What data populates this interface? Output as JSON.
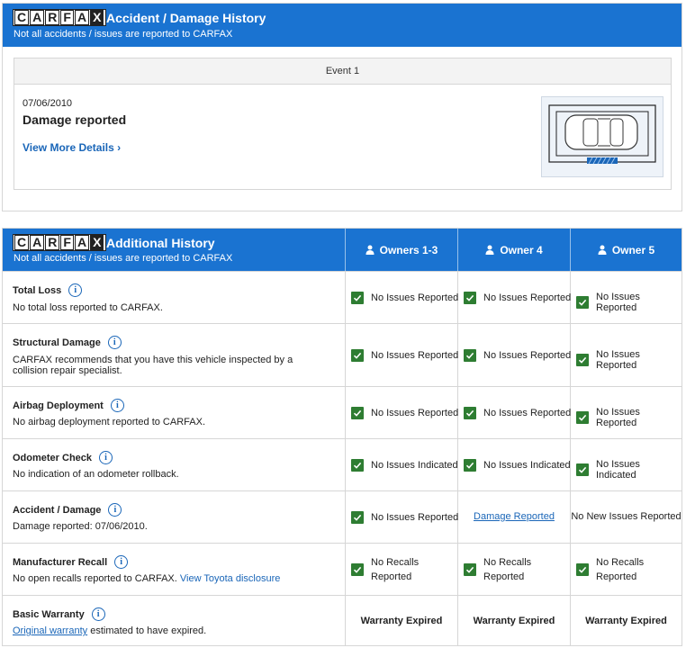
{
  "brand": {
    "letters": [
      "C",
      "A",
      "R",
      "F",
      "A",
      "X"
    ],
    "accent": "#1a73d1",
    "check_color": "#2e7d32"
  },
  "accident_card": {
    "title": "Accident / Damage History",
    "subtitle": "Not all accidents / issues are reported to CARFAX",
    "event_header": "Event 1",
    "event_date": "07/06/2010",
    "event_title": "Damage reported",
    "view_more": "View More Details ›"
  },
  "history_card": {
    "title": "Additional History",
    "subtitle": "Not all accidents / issues are reported to CARFAX",
    "owners": [
      "Owners 1-3",
      "Owner 4",
      "Owner 5"
    ],
    "rows": [
      {
        "title": "Total Loss",
        "desc": "No total loss reported to CARFAX.",
        "cells": [
          "No Issues Reported",
          "No Issues Reported",
          "No Issues Reported"
        ]
      },
      {
        "title": "Structural Damage",
        "desc": "CARFAX recommends that you have this vehicle inspected by a collision repair specialist.",
        "cells": [
          "No Issues Reported",
          "No Issues Reported",
          "No Issues Reported"
        ]
      },
      {
        "title": "Airbag Deployment",
        "desc": "No airbag deployment reported to CARFAX.",
        "cells": [
          "No Issues Reported",
          "No Issues Reported",
          "No Issues Reported"
        ]
      },
      {
        "title": "Odometer Check",
        "desc": "No indication of an odometer rollback.",
        "cells": [
          "No Issues Indicated",
          "No Issues Indicated",
          "No Issues Indicated"
        ]
      },
      {
        "title": "Accident / Damage",
        "desc": "Damage reported: 07/06/2010.",
        "cells": [
          "No Issues Reported",
          "Damage Reported",
          "No New Issues Reported"
        ]
      },
      {
        "title": "Manufacturer Recall",
        "desc": "No open recalls reported to CARFAX.",
        "desc_link": "View Toyota disclosure",
        "cells": [
          "No Recalls Reported",
          "No Recalls Reported",
          "No Recalls Reported"
        ]
      },
      {
        "title": "Basic Warranty",
        "desc_link_first": "Original warranty",
        "desc": "estimated to have expired.",
        "cells": [
          "Warranty Expired",
          "Warranty Expired",
          "Warranty Expired"
        ]
      }
    ]
  }
}
